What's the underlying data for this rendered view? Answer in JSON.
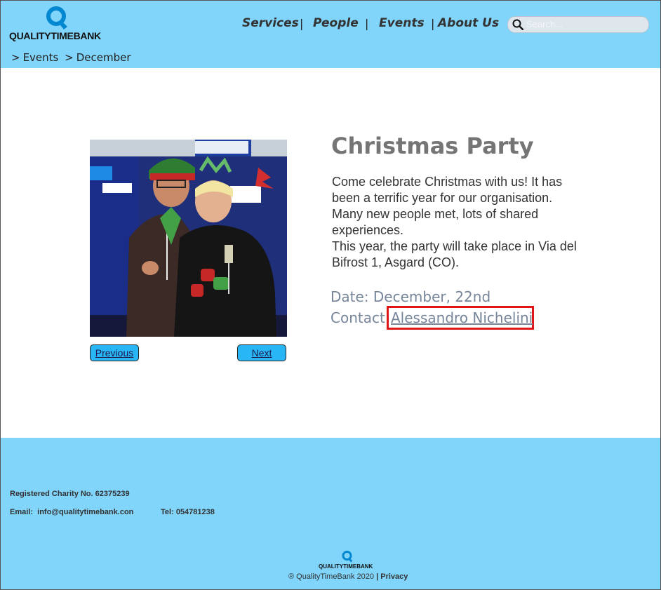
{
  "brand": {
    "name": "QUALITYTIMEBANK"
  },
  "nav": {
    "items": [
      {
        "label": "Services"
      },
      {
        "label": "People"
      },
      {
        "label": "Events"
      },
      {
        "label": "About Us"
      }
    ],
    "separator": "|"
  },
  "search": {
    "placeholder": "Search...",
    "value": ""
  },
  "breadcrumb": {
    "items": [
      ">",
      "Events",
      ">",
      "December"
    ]
  },
  "event": {
    "title": "Christmas Party",
    "description": [
      "Come celebrate Christmas with us! It has been a terrific year for our organisation.",
      "Many new people met, lots of shared experiences.",
      "This year, the party will take place in Via del Bifrost 1, Asgard (CO)."
    ],
    "date_label": "Date:",
    "date_value": "December, 22nd",
    "contact_label": "Contact:",
    "contact_name": "Alessandro Nichelini"
  },
  "pager": {
    "previous": "Previous",
    "next": "Next"
  },
  "footer": {
    "charity": "Registered Charity No. 62375239",
    "email_label": "Email:",
    "email": "info@qualitytimebank.con",
    "tel_label": "Tel:",
    "tel": "054781238",
    "brand": "QUALITYTIMEBANK",
    "copyright": "® QualityTimeBank 2020",
    "divider": "|",
    "privacy": "Privacy"
  },
  "colors": {
    "header_bg": "#81d4fa",
    "button_bg": "#29b6f6",
    "highlight_border": "#e01515",
    "muted_text": "#77859a",
    "logo_q": "#0288d1"
  }
}
